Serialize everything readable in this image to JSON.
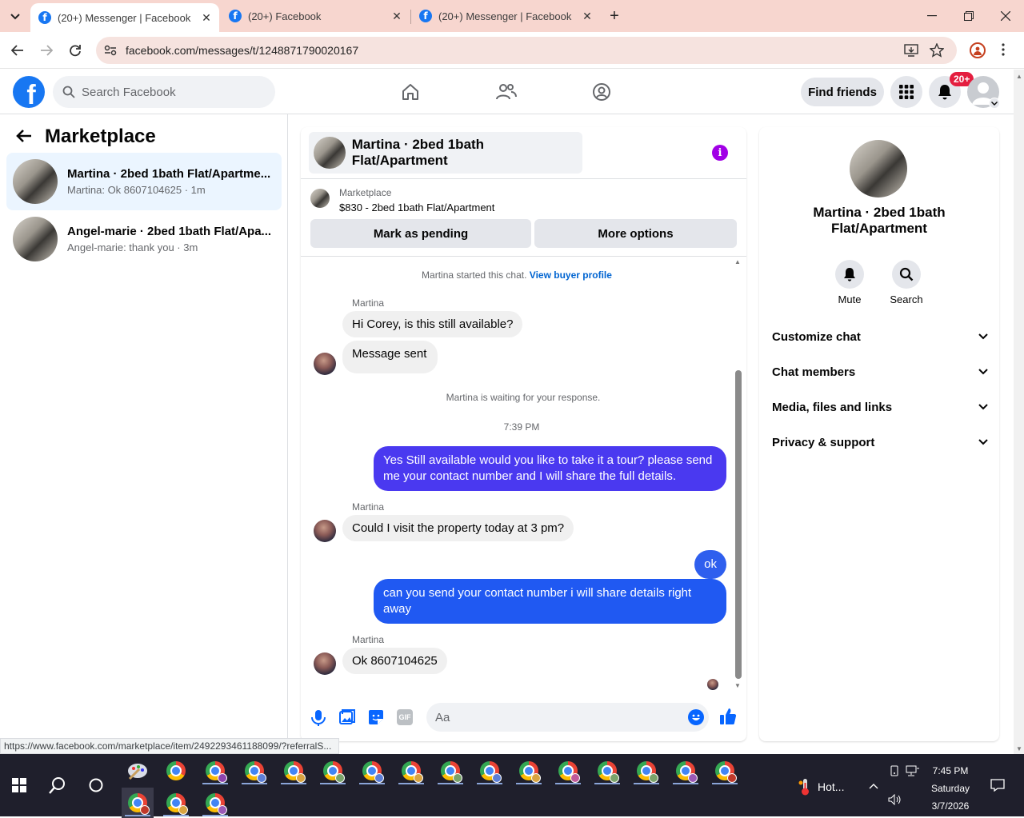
{
  "browser": {
    "tabs": [
      {
        "title": "(20+) Messenger | Facebook",
        "active": true
      },
      {
        "title": "(20+) Facebook",
        "active": false
      },
      {
        "title": "(20+) Messenger | Facebook",
        "active": false
      }
    ],
    "url": "facebook.com/messages/t/1248871790020167",
    "status_url": "https://www.facebook.com/marketplace/item/2492293461188099/?referralS..."
  },
  "fb_header": {
    "search_placeholder": "Search Facebook",
    "find_friends": "Find friends",
    "notif_badge": "20+"
  },
  "left": {
    "title": "Marketplace",
    "conversations": [
      {
        "name": "Martina · 2bed 1bath Flat/Apartme...",
        "preview": "Martina: Ok 8607104625 · 1m",
        "selected": true
      },
      {
        "name": "Angel-marie · 2bed 1bath Flat/Apa...",
        "preview": "Angel-marie: thank you · 3m",
        "selected": false
      }
    ]
  },
  "chat": {
    "title": "Martina · 2bed 1bath Flat/Apartment",
    "listing_source": "Marketplace",
    "listing_title": "$830 - 2bed 1bath Flat/Apartment",
    "btn_pending": "Mark as pending",
    "btn_more": "More options",
    "started": "Martina started this chat.",
    "buyer_profile": "View buyer profile",
    "sender_name": "Martina",
    "msg1": "Hi Corey, is this still available?",
    "msg2": "Message sent",
    "waiting": "Martina is waiting for your response.",
    "time": "7:39 PM",
    "out1": "Yes Still available would you like to take it a tour? please send me your contact number and I will share the full details.",
    "in3": "Could I visit the property today at 3 pm?",
    "out2": "ok",
    "out3": "can you send your contact number i will share details right away",
    "in4": "Ok 8607104625",
    "composer_placeholder": "Aa"
  },
  "right": {
    "name_line1": "Martina · 2bed 1bath",
    "name_line2": "Flat/Apartment",
    "mute": "Mute",
    "search": "Search",
    "rows": [
      "Customize chat",
      "Chat members",
      "Media, files and links",
      "Privacy & support"
    ]
  },
  "taskbar": {
    "weather": "Hot...",
    "time": "7:45 PM",
    "day": "Saturday",
    "date": "3/7/2026"
  },
  "colors": {
    "fb_blue": "#1877f2",
    "outgoing_bubble": "#4a39f0",
    "tabstrip": "#f7d6cf",
    "badge_red": "#e41e3f",
    "info_purple": "#a100e6"
  }
}
